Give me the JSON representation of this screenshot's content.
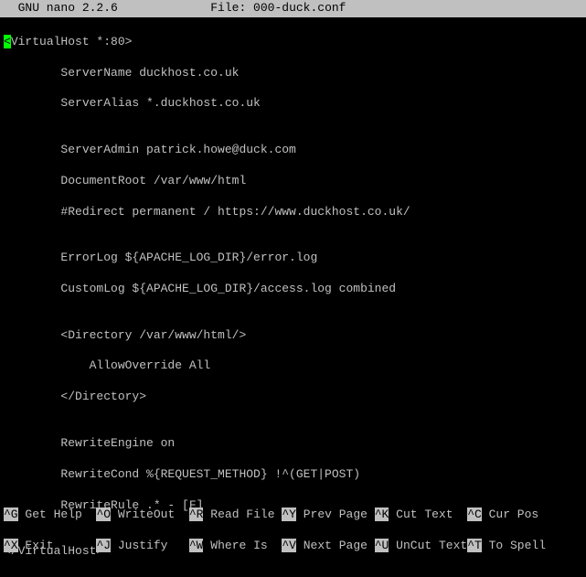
{
  "titlebar": {
    "left": "  GNU nano 2.2.6",
    "center": "File: 000-duck.conf"
  },
  "editor": {
    "cursor": "<",
    "line1_rest": "VirtualHost *:80>",
    "line2": "        ServerName duckhost.co.uk",
    "line3": "        ServerAlias *.duckhost.co.uk",
    "line4": "",
    "line5": "        ServerAdmin patrick.howe@duck.com",
    "line6": "        DocumentRoot /var/www/html",
    "line7": "        #Redirect permanent / https://www.duckhost.co.uk/",
    "line8": "",
    "line9": "        ErrorLog ${APACHE_LOG_DIR}/error.log",
    "line10": "        CustomLog ${APACHE_LOG_DIR}/access.log combined",
    "line11": "",
    "line12": "        <Directory /var/www/html/>",
    "line13": "            AllowOverride All",
    "line14": "        </Directory>",
    "line15": "",
    "line16": "        RewriteEngine on",
    "line17": "        RewriteCond %{REQUEST_METHOD} !^(GET|POST)",
    "line18": "        RewriteRule .* - [F]",
    "line19": "",
    "line20": "</VirtualHost>"
  },
  "shortcuts": {
    "row1": [
      {
        "key": "^G",
        "label": " Get Help  "
      },
      {
        "key": "^O",
        "label": " WriteOut  "
      },
      {
        "key": "^R",
        "label": " Read File "
      },
      {
        "key": "^Y",
        "label": " Prev Page "
      },
      {
        "key": "^K",
        "label": " Cut Text  "
      },
      {
        "key": "^C",
        "label": " Cur Pos"
      }
    ],
    "row2": [
      {
        "key": "^X",
        "label": " Exit      "
      },
      {
        "key": "^J",
        "label": " Justify   "
      },
      {
        "key": "^W",
        "label": " Where Is  "
      },
      {
        "key": "^V",
        "label": " Next Page "
      },
      {
        "key": "^U",
        "label": " UnCut Text"
      },
      {
        "key": "^T",
        "label": " To Spell"
      }
    ]
  }
}
